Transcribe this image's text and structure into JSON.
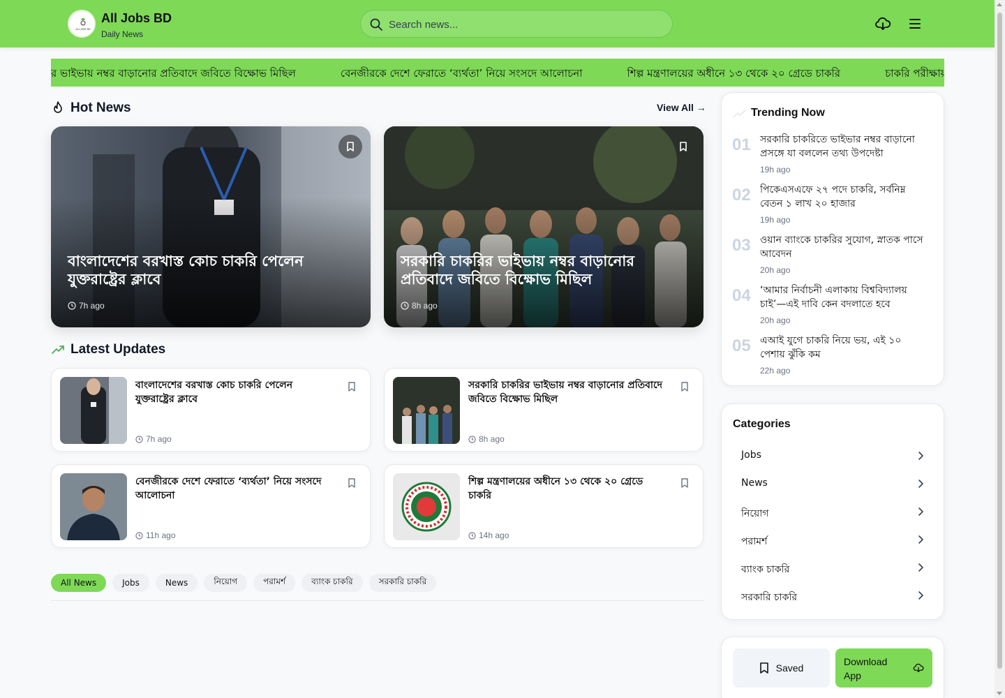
{
  "header": {
    "brand_title": "All Jobs BD",
    "brand_subtitle": "Daily News",
    "logo_text": "ALL JOBS BD",
    "search_placeholder": "Search news...",
    "accent_color": "#7ed957"
  },
  "ticker": {
    "items": [
      "র ভাইভায় নম্বর বাড়ানোর প্রতিবাদে জবিতে বিক্ষোভ মিছিল",
      "বেনজীরকে দেশে ফেরাতে ‘ব্যর্থতা’ নিয়ে সংসদে আলোচনা",
      "শিল্প মন্ত্রণালয়ের অধীনে ১৩ থেকে ২০ গ্রেডে চাকরি",
      "চাকরি পরীক্ষায় মৌ"
    ]
  },
  "hot_news": {
    "heading": "Hot News",
    "view_all": "View All →",
    "cards": [
      {
        "title": "বাংলাদেশের বরখাস্ত কোচ চাকরি পেলেন যুক্তরাষ্ট্রের ক্লাবে",
        "time": "7h ago"
      },
      {
        "title": "সরকারি চাকরির ভাইভায় নম্বর বাড়ানোর প্রতিবাদে জবিতে বিক্ষোভ মিছিল",
        "time": "8h ago"
      }
    ]
  },
  "latest": {
    "heading": "Latest Updates",
    "cards": [
      {
        "title": "বাংলাদেশের বরখাস্ত কোচ চাকরি পেলেন যুক্তরাষ্ট্রের ক্লাবে",
        "time": "7h ago"
      },
      {
        "title": "সরকারি চাকরির ভাইভায় নম্বর বাড়ানোর প্রতিবাদে জবিতে বিক্ষোভ মিছিল",
        "time": "8h ago"
      },
      {
        "title": "বেনজীরকে দেশে ফেরাতে ‘ব্যর্থতা’ নিয়ে সংসদে আলোচনা",
        "time": "11h ago"
      },
      {
        "title": "শিল্প মন্ত্রণালয়ের অধীনে ১৩ থেকে ২০ গ্রেডে চাকরি",
        "time": "14h ago"
      }
    ]
  },
  "pills": [
    "All News",
    "Jobs",
    "News",
    "নিয়োগ",
    "পরামর্শ",
    "ব্যাংক চাকরি",
    "সরকারি চাকরি"
  ],
  "trending": {
    "heading": "Trending Now",
    "items": [
      {
        "num": "01",
        "title": "সরকারি চাকরিতে ভাইভার নম্বর বাড়ানো প্রসঙ্গে যা বললেন তথ্য উপদেষ্টা",
        "time": "19h ago"
      },
      {
        "num": "02",
        "title": "পিকেএসএফে ২৭ পদে চাকরি, সর্বনিম্ন বেতন ১ লাখ ২০ হাজার",
        "time": "19h ago"
      },
      {
        "num": "03",
        "title": "ওয়ান ব্যাংকে চাকরির সুযোগ, স্নাতক পাসে আবেদন",
        "time": "20h ago"
      },
      {
        "num": "04",
        "title": "‘আমার নির্বাচনী এলাকায় বিশ্ববিদ্যালয় চাই’—এই দাবি কেন বদলাতে হবে",
        "time": "20h ago"
      },
      {
        "num": "05",
        "title": "এআই যুগে চাকরি নিয়ে ভয়, এই ১০ পেশায় ঝুঁকি কম",
        "time": "22h ago"
      }
    ]
  },
  "categories": {
    "heading": "Categories",
    "items": [
      "Jobs",
      "News",
      "নিয়োগ",
      "পরামর্শ",
      "ব্যাংক চাকরি",
      "সরকারি চাকরি"
    ]
  },
  "actions": {
    "saved": "Saved",
    "download_line1": "Download",
    "download_line2": "App"
  }
}
